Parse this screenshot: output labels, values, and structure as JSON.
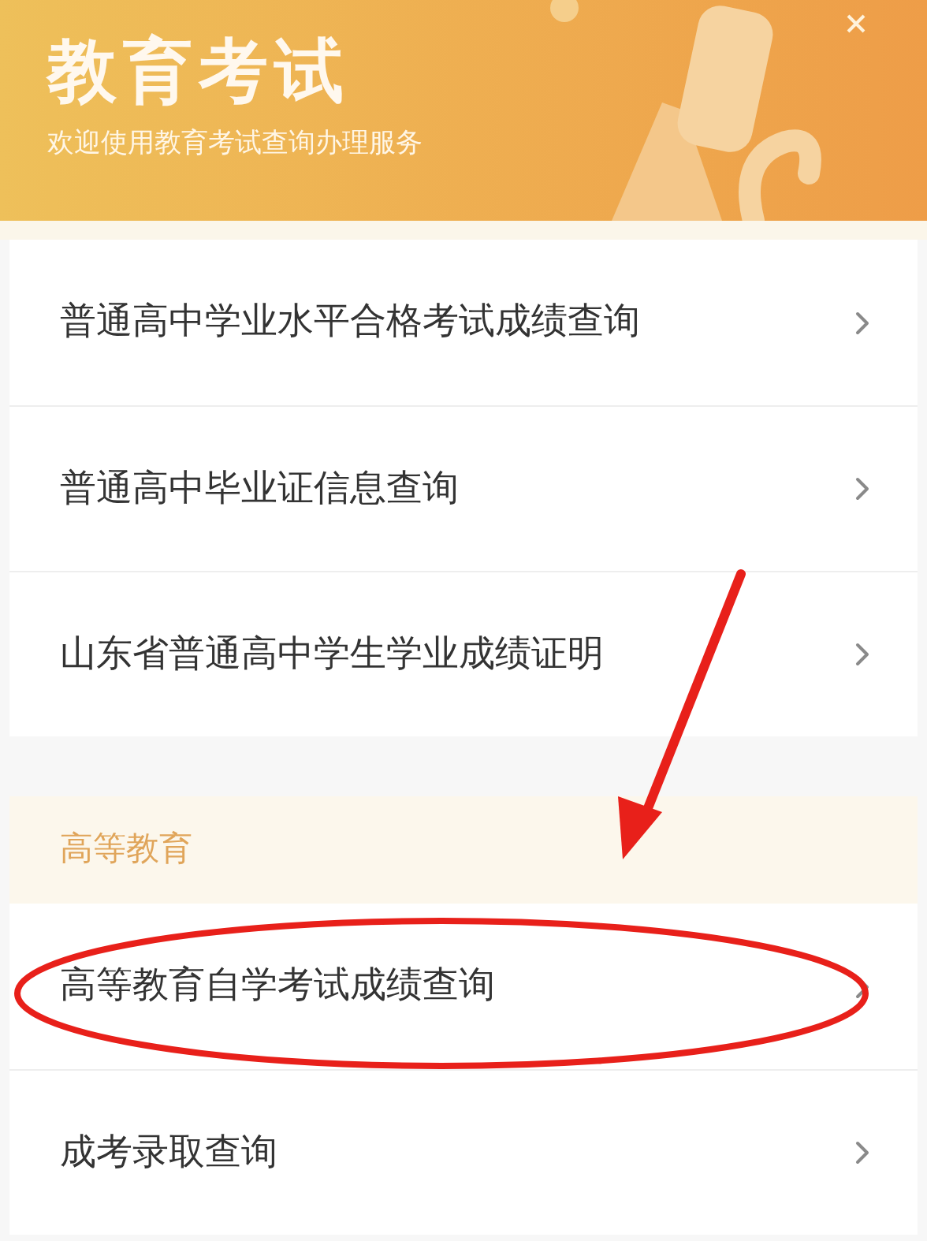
{
  "banner": {
    "title": "教育考试",
    "subtitle": "欢迎使用教育考试查询办理服务"
  },
  "sections": [
    {
      "items": [
        {
          "label": "普通高中学业水平合格考试成绩查询"
        },
        {
          "label": "普通高中毕业证信息查询"
        },
        {
          "label": "山东省普通高中学生学业成绩证明"
        }
      ]
    },
    {
      "heading": "高等教育",
      "items": [
        {
          "label": "高等教育自学考试成绩查询"
        },
        {
          "label": "成考录取查询"
        }
      ]
    }
  ]
}
